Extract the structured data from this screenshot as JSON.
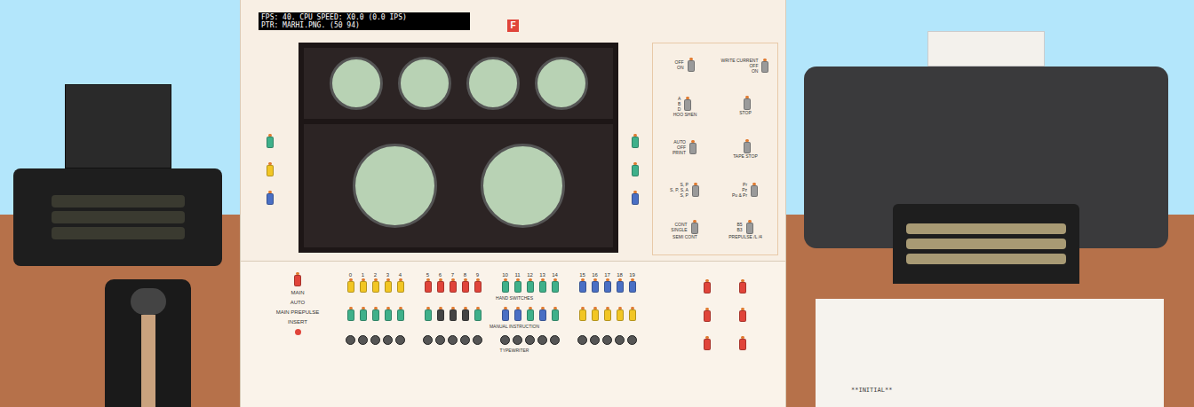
{
  "status": {
    "lines": [
      "FPS: 40. CPU SPEED: X0.0 (0.0 IPS)",
      "PTR: MARHI.PNG. (50 94)"
    ]
  },
  "logo": "F",
  "screens": [
    {
      "kind": "small"
    },
    {
      "kind": "small"
    },
    {
      "kind": "small"
    },
    {
      "kind": "small"
    },
    {
      "kind": "large"
    },
    {
      "kind": "large"
    }
  ],
  "side_switches": {
    "left": [
      {
        "color": "#3fb08a"
      },
      {
        "color": "#f2c624"
      },
      {
        "color": "#4a6fc4"
      }
    ],
    "right": [
      {
        "color": "#3fb08a"
      },
      {
        "color": "#3fb08a"
      },
      {
        "color": "#4a6fc4"
      }
    ]
  },
  "control_panel": [
    {
      "cells": [
        {
          "labels": [
            "OFF",
            "ON"
          ],
          "caption": ""
        },
        {
          "labels": [
            "WRITE CURRENT",
            "OFF",
            "ON"
          ],
          "caption": ""
        }
      ]
    },
    {
      "cells": [
        {
          "labels": [
            "A",
            "B",
            "D"
          ],
          "caption": "HOO SHEN"
        },
        {
          "labels": [],
          "caption": "STOP"
        }
      ]
    },
    {
      "cells": [
        {
          "labels": [
            "AUTO",
            "OFF",
            "PRINT"
          ],
          "caption": ""
        },
        {
          "labels": [],
          "caption": "TAPE STOP"
        }
      ]
    },
    {
      "cells": [
        {
          "labels": [
            "S, P",
            "S, P, S, A",
            "S, P"
          ],
          "caption": ""
        },
        {
          "labels": [
            "Pr",
            "Pz",
            "Pu & Pr"
          ],
          "caption": ""
        }
      ]
    },
    {
      "cells": [
        {
          "labels": [
            "CONT",
            "SINGLE"
          ],
          "caption": "SEMI CONT"
        },
        {
          "labels": [
            "B5",
            "B3"
          ],
          "caption": "PREPULSE /L /4"
        }
      ]
    }
  ],
  "left_controls": {
    "labels": [
      "MAIN",
      "AUTO",
      "MAIN PREPULSE",
      "INSERT"
    ],
    "color": "#e0443a"
  },
  "hand_switches": {
    "label": "HAND SWITCHES",
    "switches": [
      {
        "number": "0",
        "color": "#f2c624"
      },
      {
        "number": "1",
        "color": "#f2c624"
      },
      {
        "number": "2",
        "color": "#f2c624"
      },
      {
        "number": "3",
        "color": "#f2c624"
      },
      {
        "number": "4",
        "color": "#f2c624"
      },
      {
        "number": "5",
        "color": "#e0443a"
      },
      {
        "number": "6",
        "color": "#e0443a"
      },
      {
        "number": "7",
        "color": "#e0443a"
      },
      {
        "number": "8",
        "color": "#e0443a"
      },
      {
        "number": "9",
        "color": "#e0443a"
      },
      {
        "number": "10",
        "color": "#3fb08a"
      },
      {
        "number": "11",
        "color": "#3fb08a"
      },
      {
        "number": "12",
        "color": "#3fb08a"
      },
      {
        "number": "13",
        "color": "#3fb08a"
      },
      {
        "number": "14",
        "color": "#3fb08a"
      },
      {
        "number": "15",
        "color": "#4a6fc4"
      },
      {
        "number": "16",
        "color": "#4a6fc4"
      },
      {
        "number": "17",
        "color": "#4a6fc4"
      },
      {
        "number": "18",
        "color": "#4a6fc4"
      },
      {
        "number": "19",
        "color": "#4a6fc4"
      }
    ]
  },
  "manual_instruction": {
    "label": "MANUAL INSTRUCTION",
    "switches": [
      {
        "color": "#3fb08a"
      },
      {
        "color": "#3fb08a"
      },
      {
        "color": "#3fb08a"
      },
      {
        "color": "#3fb08a"
      },
      {
        "color": "#3fb08a"
      },
      {
        "color": "#3fb08a"
      },
      {
        "color": "#444444"
      },
      {
        "color": "#444444"
      },
      {
        "color": "#444444"
      },
      {
        "color": "#3fb08a"
      },
      {
        "color": "#4a6fc4"
      },
      {
        "color": "#4a6fc4"
      },
      {
        "color": "#3fb08a"
      },
      {
        "color": "#4a6fc4"
      },
      {
        "color": "#3fb08a"
      },
      {
        "color": "#f2c624"
      },
      {
        "color": "#f2c624"
      },
      {
        "color": "#f2c624"
      },
      {
        "color": "#f2c624"
      },
      {
        "color": "#f2c624"
      }
    ]
  },
  "typewriter_buttons": {
    "label": "TYPEWRITER",
    "count": 20
  },
  "right_switches": [
    {
      "color": "#e0443a"
    },
    {
      "color": "#e0443a"
    },
    {
      "color": "#e0443a"
    },
    {
      "color": "#e0443a"
    },
    {
      "color": "#e0443a"
    },
    {
      "color": "#e0443a"
    }
  ],
  "printer_paper": {
    "text": "**INITIAL**"
  }
}
